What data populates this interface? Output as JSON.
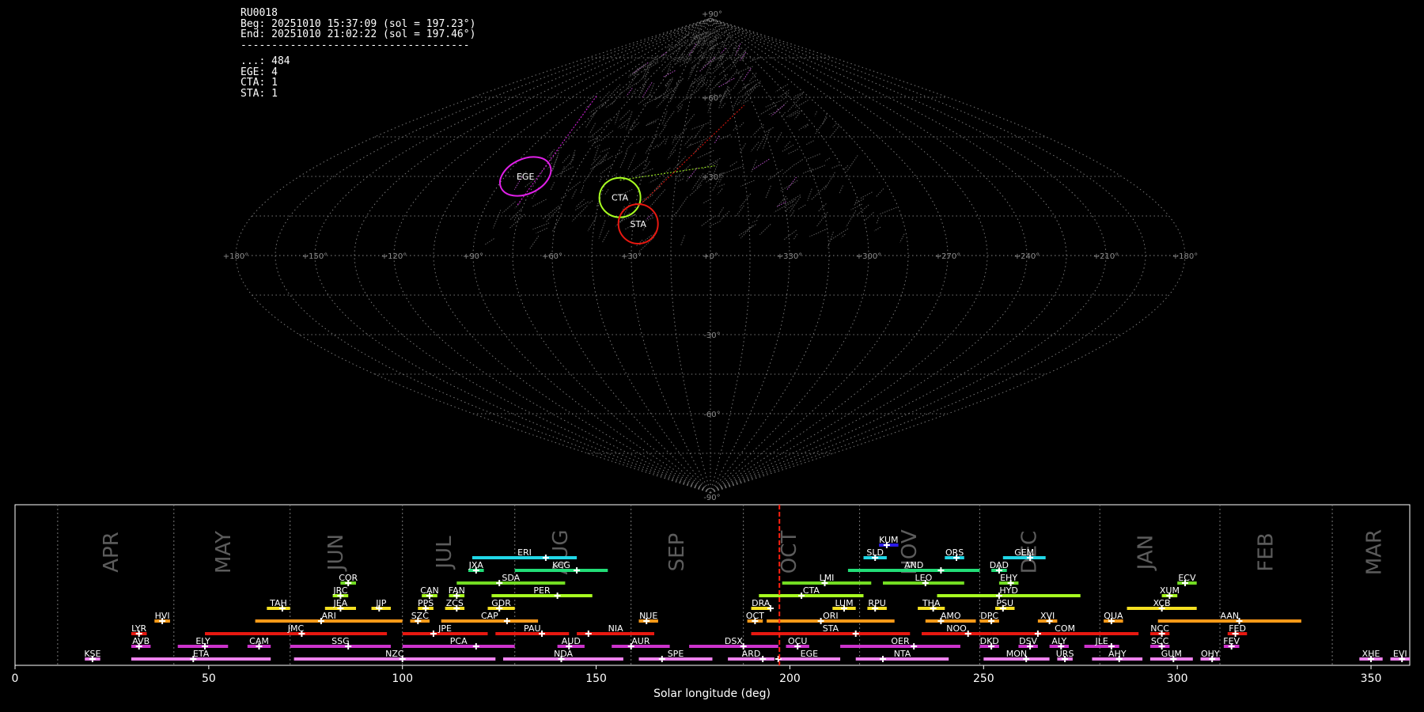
{
  "header": {
    "station": "RU0018",
    "begin": "Beg: 20251010 15:37:09 (sol = 197.23°)",
    "end": "End: 20251010 21:02:22 (sol = 197.46°)",
    "divider": "-------------------------------------",
    "counts": [
      {
        "label": "...",
        "value": "484"
      },
      {
        "label": "EGE",
        "value": "4"
      },
      {
        "label": "CTA",
        "value": "1"
      },
      {
        "label": "STA",
        "value": "1"
      }
    ]
  },
  "sky_map": {
    "projection": "sinusoidal",
    "lon_labels": [
      "+180°",
      "+150°",
      "+120°",
      "+90°",
      "+60°",
      "+30°",
      "+0°",
      "+330°",
      "+300°",
      "+270°",
      "+240°",
      "+210°",
      "+180°"
    ],
    "lat_labels": [
      "+90°",
      "+60°",
      "+30°",
      "-30°",
      "-60°",
      "-90°"
    ],
    "radiants": [
      {
        "code": "EGE",
        "lon": 81,
        "lat": 30,
        "color": "#e020e8"
      },
      {
        "code": "CTA",
        "lon": 37,
        "lat": 22,
        "color": "#a8ff20"
      },
      {
        "code": "STA",
        "lon": 28,
        "lat": 12,
        "color": "#e81810"
      }
    ]
  },
  "chart_data": {
    "type": "timeline",
    "xlabel": "Solar longitude (deg)",
    "xlim": [
      0,
      360
    ],
    "xticks": [
      0,
      50,
      100,
      150,
      200,
      250,
      300,
      350
    ],
    "current_sol": 197.3,
    "months": [
      {
        "name": "APR",
        "at": 25,
        "boundary": 11
      },
      {
        "name": "MAY",
        "at": 54,
        "boundary": 41
      },
      {
        "name": "JUN",
        "at": 83,
        "boundary": 71
      },
      {
        "name": "JUL",
        "at": 111,
        "boundary": 100
      },
      {
        "name": "AUG",
        "at": 141,
        "boundary": 129
      },
      {
        "name": "SEP",
        "at": 171,
        "boundary": 159
      },
      {
        "name": "OCT",
        "at": 200,
        "boundary": 188
      },
      {
        "name": "NOV",
        "at": 231,
        "boundary": 218
      },
      {
        "name": "DEC",
        "at": 262,
        "boundary": 249
      },
      {
        "name": "JAN",
        "at": 292,
        "boundary": 280
      },
      {
        "name": "FEB",
        "at": 323,
        "boundary": 311
      },
      {
        "name": "MAR",
        "at": 351,
        "boundary": 340
      }
    ],
    "showers": [
      {
        "code": "KSE",
        "start": 18,
        "end": 22,
        "peak": 20,
        "row": 0,
        "color": "#ee82ee"
      },
      {
        "code": "ETA",
        "start": 30,
        "end": 66,
        "peak": 46,
        "row": 0,
        "color": "#ee82ee"
      },
      {
        "code": "NZC",
        "start": 72,
        "end": 124,
        "peak": 100,
        "row": 0,
        "color": "#ee82ee"
      },
      {
        "code": "NDA",
        "start": 126,
        "end": 157,
        "peak": 141,
        "row": 0,
        "color": "#ee82ee"
      },
      {
        "code": "SPE",
        "start": 161,
        "end": 180,
        "peak": 167,
        "row": 0,
        "color": "#ee82ee"
      },
      {
        "code": "ARD",
        "start": 184,
        "end": 196,
        "peak": 193,
        "row": 0,
        "color": "#ee82ee"
      },
      {
        "code": "EGE",
        "start": 197,
        "end": 213,
        "peak": 197,
        "row": 0,
        "color": "#ee82ee"
      },
      {
        "code": "NTA",
        "start": 217,
        "end": 241,
        "peak": 224,
        "row": 0,
        "color": "#ee82ee"
      },
      {
        "code": "MON",
        "start": 250,
        "end": 267,
        "peak": 261,
        "row": 0,
        "color": "#ee82ee"
      },
      {
        "code": "URS",
        "start": 269,
        "end": 273,
        "peak": 271,
        "row": 0,
        "color": "#ee82ee"
      },
      {
        "code": "AHY",
        "start": 278,
        "end": 291,
        "peak": 285,
        "row": 0,
        "color": "#ee82ee"
      },
      {
        "code": "GUM",
        "start": 293,
        "end": 304,
        "peak": 299,
        "row": 0,
        "color": "#ee82ee"
      },
      {
        "code": "OHY",
        "start": 306,
        "end": 311,
        "peak": 309,
        "row": 0,
        "color": "#ee82ee"
      },
      {
        "code": "XHE",
        "start": 347,
        "end": 353,
        "peak": 350,
        "row": 0,
        "color": "#ee82ee"
      },
      {
        "code": "EVI",
        "start": 355,
        "end": 360,
        "peak": 358,
        "row": 0,
        "color": "#ee82ee"
      },
      {
        "code": "AVB",
        "start": 30,
        "end": 35,
        "peak": 32,
        "row": 1,
        "color": "#cc33cc"
      },
      {
        "code": "ELY",
        "start": 42,
        "end": 55,
        "peak": 49,
        "row": 1,
        "color": "#cc33cc"
      },
      {
        "code": "CAM",
        "start": 60,
        "end": 66,
        "peak": 63,
        "row": 1,
        "color": "#cc33cc"
      },
      {
        "code": "SSG",
        "start": 71,
        "end": 97,
        "peak": 86,
        "row": 1,
        "color": "#cc33cc"
      },
      {
        "code": "PCA",
        "start": 100,
        "end": 129,
        "peak": 119,
        "row": 1,
        "color": "#cc33cc"
      },
      {
        "code": "AUD",
        "start": 140,
        "end": 147,
        "peak": 143,
        "row": 1,
        "color": "#cc33cc"
      },
      {
        "code": "AUR",
        "start": 154,
        "end": 169,
        "peak": 159,
        "row": 1,
        "color": "#cc33cc"
      },
      {
        "code": "DSX",
        "start": 174,
        "end": 197,
        "peak": 188,
        "row": 1,
        "color": "#cc33cc"
      },
      {
        "code": "OCU",
        "start": 199,
        "end": 205,
        "peak": 202,
        "row": 1,
        "color": "#cc33cc"
      },
      {
        "code": "OER",
        "start": 213,
        "end": 244,
        "peak": 232,
        "row": 1,
        "color": "#cc33cc"
      },
      {
        "code": "DKD",
        "start": 249,
        "end": 254,
        "peak": 252,
        "row": 1,
        "color": "#cc33cc"
      },
      {
        "code": "DSV",
        "start": 259,
        "end": 264,
        "peak": 262,
        "row": 1,
        "color": "#cc33cc"
      },
      {
        "code": "ALY",
        "start": 267,
        "end": 272,
        "peak": 270,
        "row": 1,
        "color": "#cc33cc"
      },
      {
        "code": "JLE",
        "start": 276,
        "end": 285,
        "peak": 283,
        "row": 1,
        "color": "#cc33cc"
      },
      {
        "code": "SCC",
        "start": 293,
        "end": 298,
        "peak": 296,
        "row": 1,
        "color": "#cc33cc"
      },
      {
        "code": "FEV",
        "start": 312,
        "end": 316,
        "peak": 314,
        "row": 1,
        "color": "#cc33cc"
      },
      {
        "code": "LYR",
        "start": 30,
        "end": 34,
        "peak": 32,
        "row": 2,
        "color": "#e81810"
      },
      {
        "code": "JMC",
        "start": 49,
        "end": 96,
        "peak": 74,
        "row": 2,
        "color": "#e81810"
      },
      {
        "code": "JPE",
        "start": 100,
        "end": 122,
        "peak": 108,
        "row": 2,
        "color": "#e81810"
      },
      {
        "code": "PAU",
        "start": 124,
        "end": 143,
        "peak": 136,
        "row": 2,
        "color": "#e81810"
      },
      {
        "code": "NIA",
        "start": 145,
        "end": 165,
        "peak": 148,
        "row": 2,
        "color": "#e81810"
      },
      {
        "code": "STA",
        "start": 190,
        "end": 231,
        "peak": 217,
        "row": 2,
        "color": "#e81810"
      },
      {
        "code": "NOO",
        "start": 234,
        "end": 252,
        "peak": 246,
        "row": 2,
        "color": "#e81810"
      },
      {
        "code": "COM",
        "start": 252,
        "end": 290,
        "peak": 264,
        "row": 2,
        "color": "#e81810"
      },
      {
        "code": "NCC",
        "start": 293,
        "end": 298,
        "peak": 296,
        "row": 2,
        "color": "#e81810"
      },
      {
        "code": "FED",
        "start": 313,
        "end": 318,
        "peak": 315,
        "row": 2,
        "color": "#e81810"
      },
      {
        "code": "HVI",
        "start": 36,
        "end": 40,
        "peak": 38,
        "row": 3,
        "color": "#ff9a18"
      },
      {
        "code": "ARI",
        "start": 62,
        "end": 100,
        "peak": 79,
        "row": 3,
        "color": "#ff9a18"
      },
      {
        "code": "SZC",
        "start": 102,
        "end": 107,
        "peak": 104,
        "row": 3,
        "color": "#ff9a18"
      },
      {
        "code": "CAP",
        "start": 110,
        "end": 135,
        "peak": 127,
        "row": 3,
        "color": "#ff9a18"
      },
      {
        "code": "NUE",
        "start": 161,
        "end": 166,
        "peak": 163,
        "row": 3,
        "color": "#ff9a18"
      },
      {
        "code": "OCT",
        "start": 189,
        "end": 193,
        "peak": 191,
        "row": 3,
        "color": "#ff9a18"
      },
      {
        "code": "ORI",
        "start": 194,
        "end": 227,
        "peak": 208,
        "row": 3,
        "color": "#ff9a18"
      },
      {
        "code": "AMO",
        "start": 235,
        "end": 248,
        "peak": 239,
        "row": 3,
        "color": "#ff9a18"
      },
      {
        "code": "DPC",
        "start": 249,
        "end": 254,
        "peak": 252,
        "row": 3,
        "color": "#ff9a18"
      },
      {
        "code": "XVI",
        "start": 264,
        "end": 269,
        "peak": 267,
        "row": 3,
        "color": "#ff9a18"
      },
      {
        "code": "QUA",
        "start": 281,
        "end": 286,
        "peak": 283,
        "row": 3,
        "color": "#ff9a18"
      },
      {
        "code": "AAN",
        "start": 295,
        "end": 332,
        "peak": 316,
        "row": 3,
        "color": "#ff9a18"
      },
      {
        "code": "TAH",
        "start": 65,
        "end": 71,
        "peak": 69,
        "row": 4,
        "color": "#f5e022"
      },
      {
        "code": "JEA",
        "start": 80,
        "end": 88,
        "peak": 84,
        "row": 4,
        "color": "#f5e022"
      },
      {
        "code": "JIP",
        "start": 92,
        "end": 97,
        "peak": 94,
        "row": 4,
        "color": "#f5e022"
      },
      {
        "code": "PPS",
        "start": 104,
        "end": 108,
        "peak": 106,
        "row": 4,
        "color": "#f5e022"
      },
      {
        "code": "ZCS",
        "start": 111,
        "end": 116,
        "peak": 114,
        "row": 4,
        "color": "#f5e022"
      },
      {
        "code": "GDR",
        "start": 122,
        "end": 129,
        "peak": 125,
        "row": 4,
        "color": "#f5e022"
      },
      {
        "code": "DRA",
        "start": 190,
        "end": 195,
        "peak": 195,
        "row": 4,
        "color": "#f5e022"
      },
      {
        "code": "LUM",
        "start": 211,
        "end": 217,
        "peak": 214,
        "row": 4,
        "color": "#f5e022"
      },
      {
        "code": "RPU",
        "start": 220,
        "end": 225,
        "peak": 222,
        "row": 4,
        "color": "#f5e022"
      },
      {
        "code": "THA",
        "start": 233,
        "end": 240,
        "peak": 237,
        "row": 4,
        "color": "#f5e022"
      },
      {
        "code": "PSU",
        "start": 253,
        "end": 258,
        "peak": 255,
        "row": 4,
        "color": "#f5e022"
      },
      {
        "code": "XCB",
        "start": 287,
        "end": 305,
        "peak": 296,
        "row": 4,
        "color": "#f5e022"
      },
      {
        "code": "JRC",
        "start": 82,
        "end": 86,
        "peak": 84,
        "row": 5,
        "color": "#a8ff20"
      },
      {
        "code": "CAN",
        "start": 105,
        "end": 109,
        "peak": 107,
        "row": 5,
        "color": "#a8ff20"
      },
      {
        "code": "FAN",
        "start": 112,
        "end": 116,
        "peak": 114,
        "row": 5,
        "color": "#a8ff20"
      },
      {
        "code": "PER",
        "start": 123,
        "end": 149,
        "peak": 140,
        "row": 5,
        "color": "#a8ff20"
      },
      {
        "code": "CTA",
        "start": 192,
        "end": 219,
        "peak": 203,
        "row": 5,
        "color": "#a8ff20"
      },
      {
        "code": "HYD",
        "start": 238,
        "end": 275,
        "peak": 254,
        "row": 5,
        "color": "#a8ff20"
      },
      {
        "code": "XUM",
        "start": 296,
        "end": 300,
        "peak": 298,
        "row": 5,
        "color": "#a8ff20"
      },
      {
        "code": "COR",
        "start": 84,
        "end": 88,
        "peak": 86,
        "row": 6,
        "color": "#73dd22"
      },
      {
        "code": "SDA",
        "start": 114,
        "end": 142,
        "peak": 125,
        "row": 6,
        "color": "#73dd22"
      },
      {
        "code": "LMI",
        "start": 198,
        "end": 221,
        "peak": 209,
        "row": 6,
        "color": "#73dd22"
      },
      {
        "code": "LEO",
        "start": 224,
        "end": 245,
        "peak": 235,
        "row": 6,
        "color": "#73dd22"
      },
      {
        "code": "EHY",
        "start": 254,
        "end": 259,
        "peak": 257,
        "row": 6,
        "color": "#73dd22"
      },
      {
        "code": "ECV",
        "start": 300,
        "end": 305,
        "peak": 302,
        "row": 6,
        "color": "#73dd22"
      },
      {
        "code": "JXA",
        "start": 117,
        "end": 121,
        "peak": 119,
        "row": 7,
        "color": "#22dd77"
      },
      {
        "code": "KCG",
        "start": 129,
        "end": 153,
        "peak": 145,
        "row": 7,
        "color": "#22dd77"
      },
      {
        "code": "AND",
        "start": 215,
        "end": 249,
        "peak": 239,
        "row": 7,
        "color": "#22dd77"
      },
      {
        "code": "DAD",
        "start": 252,
        "end": 256,
        "peak": 254,
        "row": 7,
        "color": "#22dd77"
      },
      {
        "code": "ERI",
        "start": 118,
        "end": 145,
        "peak": 137,
        "row": 8,
        "color": "#20d8e8"
      },
      {
        "code": "SLD",
        "start": 219,
        "end": 225,
        "peak": 222,
        "row": 8,
        "color": "#20d8e8"
      },
      {
        "code": "ORS",
        "start": 240,
        "end": 245,
        "peak": 243,
        "row": 8,
        "color": "#20d8e8"
      },
      {
        "code": "GEM",
        "start": 255,
        "end": 266,
        "peak": 262,
        "row": 8,
        "color": "#20d8e8"
      },
      {
        "code": "KUM",
        "start": 223,
        "end": 228,
        "peak": 225,
        "row": 9,
        "color": "#2a1ae8"
      }
    ]
  }
}
